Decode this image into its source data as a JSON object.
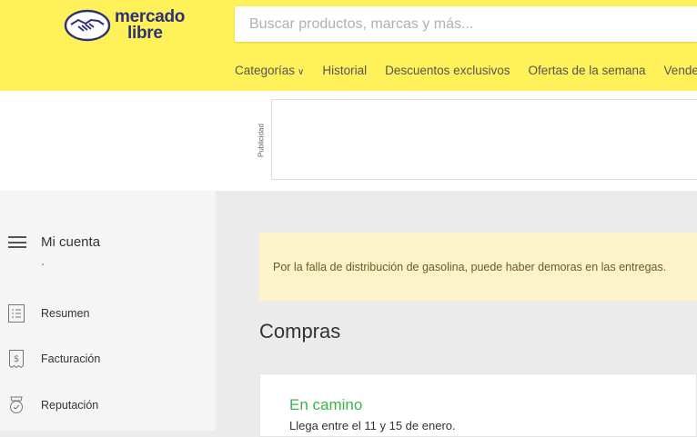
{
  "colors": {
    "header_bg": "#fff159",
    "brand_text": "#2d3277",
    "status_green": "#39b54a",
    "notice_bg": "#fdf3c9"
  },
  "header": {
    "logo_line1": "mercado",
    "logo_line2": "libre",
    "search_placeholder": "Buscar productos, marcas y más...",
    "nav": [
      "Categorías",
      "Historial",
      "Descuentos exclusivos",
      "Ofertas de la semana",
      "Vender"
    ]
  },
  "ad": {
    "label": "Publicidad"
  },
  "sidebar": {
    "title": "Mi cuenta",
    "items": [
      {
        "label": "Resumen",
        "icon": "list-icon"
      },
      {
        "label": "Facturación",
        "icon": "invoice-icon"
      },
      {
        "label": "Reputación",
        "icon": "badge-icon"
      }
    ]
  },
  "notice": {
    "text": "Por la falla de distribución de gasolina, puede haber demoras en las entregas."
  },
  "main": {
    "title": "Compras",
    "purchase": {
      "status": "En camino",
      "eta": "Llega entre el 11 y 15 de enero."
    }
  }
}
